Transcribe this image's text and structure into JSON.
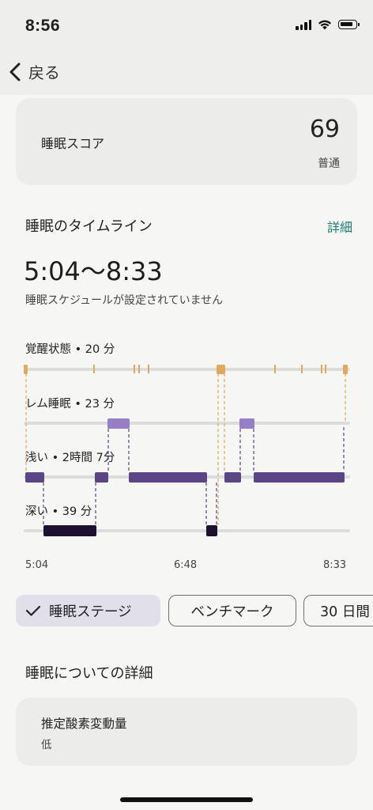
{
  "status_bar": {
    "time": "8:56"
  },
  "nav": {
    "back_label": "戻る"
  },
  "score": {
    "label": "睡眠スコア",
    "value": "69",
    "status": "普通"
  },
  "timeline": {
    "title": "睡眠のタイムライン",
    "detail_link": "詳細",
    "range": "5:04〜8:33",
    "note": "睡眠スケジュールが設定されていません",
    "stages": [
      {
        "key": "awake",
        "label": "覚醒状態 • 20 分"
      },
      {
        "key": "rem",
        "label": "レム睡眠 • 23 分"
      },
      {
        "key": "light",
        "label": "浅い • 2時間 7分"
      },
      {
        "key": "deep",
        "label": "深い • 39 分"
      }
    ],
    "axis": {
      "start": "5:04",
      "mid": "6:48",
      "end": "8:33"
    },
    "colors": {
      "awake": "#e0a85c",
      "rem": "#9580c8",
      "light": "#5b4587",
      "deep": "#1e1030",
      "track": "#dcdcdc"
    }
  },
  "chips": {
    "stages": "睡眠ステージ",
    "benchmark": "ベンチマーク",
    "thirty_days": "30 日間"
  },
  "details": {
    "title": "睡眠についての詳細",
    "item_name": "推定酸素変動量",
    "item_value": "低"
  }
}
